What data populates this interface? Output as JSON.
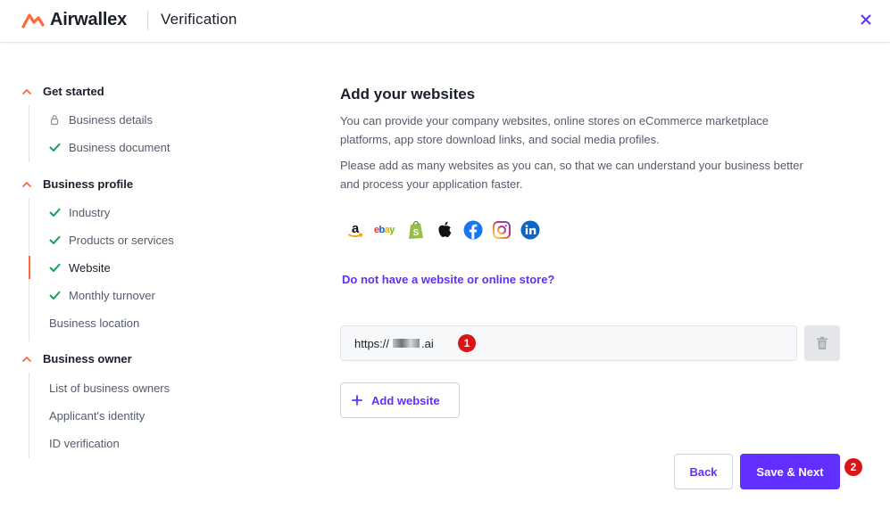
{
  "header": {
    "logo_text": "Airwallex",
    "title": "Verification",
    "close_icon": "close-icon"
  },
  "colors": {
    "accent": "#612fff",
    "brand_orange": "#ff6a3d",
    "check_green": "#12a35a",
    "badge_red": "#d91515"
  },
  "sidebar": {
    "sections": [
      {
        "label": "Get started",
        "items": [
          {
            "label": "Business details",
            "icon": "lock-icon"
          },
          {
            "label": "Business document",
            "icon": "check-icon"
          }
        ]
      },
      {
        "label": "Business profile",
        "items": [
          {
            "label": "Industry",
            "icon": "check-icon"
          },
          {
            "label": "Products or services",
            "icon": "check-icon"
          },
          {
            "label": "Website",
            "icon": "check-icon",
            "active": true
          },
          {
            "label": "Monthly turnover",
            "icon": "check-icon"
          },
          {
            "label": "Business location",
            "icon": ""
          }
        ]
      },
      {
        "label": "Business owner",
        "items": [
          {
            "label": "List of business owners",
            "icon": ""
          },
          {
            "label": "Applicant's identity",
            "icon": ""
          },
          {
            "label": "ID verification",
            "icon": ""
          }
        ]
      }
    ]
  },
  "main": {
    "title": "Add your websites",
    "paragraph1": "You can provide your company websites, online stores on eCommerce marketplace platforms, app store download links, and social media profiles.",
    "paragraph2": "Please add as many websites as you can, so that we can understand your business better and process your application faster.",
    "platform_icons": [
      "amazon-icon",
      "ebay-icon",
      "shopify-icon",
      "apple-icon",
      "facebook-icon",
      "instagram-icon",
      "linkedin-icon"
    ],
    "ebay_text": "ebay",
    "no_website_link": "Do not have a website or online store?",
    "url_prefix": "https://",
    "url_suffix": ".ai",
    "url_badge": "1",
    "add_website_label": "Add website"
  },
  "footer": {
    "back_label": "Back",
    "next_label": "Save & Next",
    "next_badge": "2"
  }
}
